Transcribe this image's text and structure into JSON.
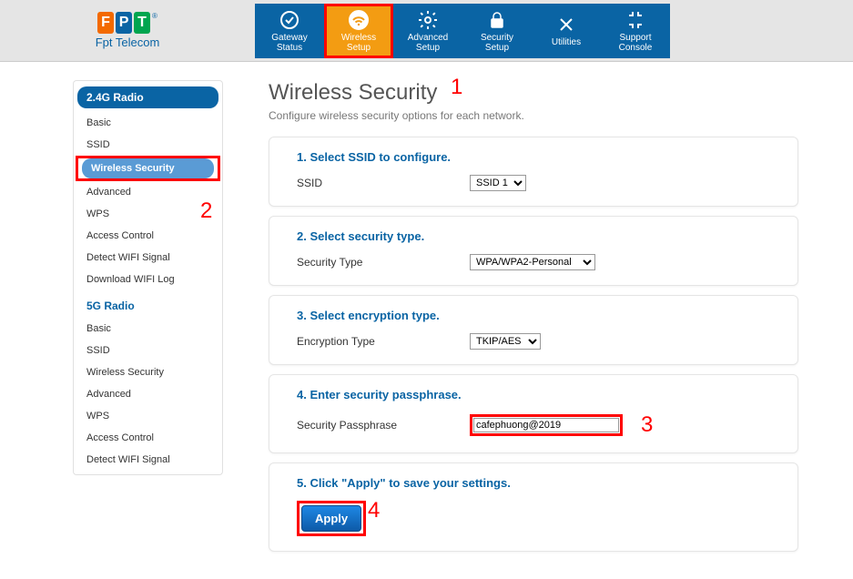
{
  "brand": {
    "name": "Fpt Telecom"
  },
  "nav": [
    {
      "label": "Gateway\nStatus"
    },
    {
      "label": "Wireless\nSetup"
    },
    {
      "label": "Advanced\nSetup"
    },
    {
      "label": "Security\nSetup"
    },
    {
      "label": "Utilities"
    },
    {
      "label": "Support\nConsole"
    }
  ],
  "sidebar": {
    "section24": "2.4G Radio",
    "items24": [
      "Basic",
      "SSID",
      "Wireless Security",
      "Advanced",
      "WPS",
      "Access Control",
      "Detect WIFI Signal",
      "Download WIFI Log"
    ],
    "section5": "5G Radio",
    "items5": [
      "Basic",
      "SSID",
      "Wireless Security",
      "Advanced",
      "WPS",
      "Access Control",
      "Detect WIFI Signal"
    ]
  },
  "page": {
    "title": "Wireless Security",
    "subtitle": "Configure wireless security options for each network."
  },
  "card1": {
    "title": "1. Select SSID to configure.",
    "label": "SSID",
    "value": "SSID 1"
  },
  "card2": {
    "title": "2. Select security type.",
    "label": "Security Type",
    "value": "WPA/WPA2-Personal"
  },
  "card3": {
    "title": "3. Select encryption type.",
    "label": "Encryption Type",
    "value": "TKIP/AES"
  },
  "card4": {
    "title": "4. Enter security passphrase.",
    "label": "Security Passphrase",
    "value": "cafephuong@2019"
  },
  "card5": {
    "title": "5. Click \"Apply\" to save your settings.",
    "button": "Apply"
  },
  "annotations": {
    "a1": "1",
    "a2": "2",
    "a3": "3",
    "a4": "4"
  }
}
